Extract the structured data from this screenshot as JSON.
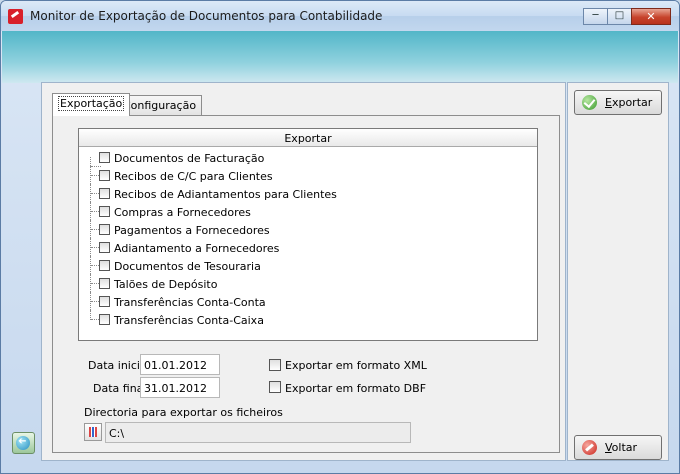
{
  "window": {
    "title": "Monitor de Exportação de Documentos para Contabilidade",
    "controls": {
      "minimize": "─",
      "maximize": "□",
      "close": "✕"
    }
  },
  "tabs": {
    "export": "Exportação",
    "config": "Configuração"
  },
  "list": {
    "header": "Exportar",
    "items": [
      "Documentos de Facturação",
      "Recibos de C/C para Clientes",
      "Recibos de Adiantamentos para Clientes",
      "Compras a Fornecedores",
      "Pagamentos a Fornecedores",
      "Adiantamento a Fornecedores",
      "Documentos de Tesouraria",
      "Talões de Depósito",
      "Transferências Conta-Conta",
      "Transferências Conta-Caixa"
    ]
  },
  "dates": {
    "start_label": "Data inicial",
    "start_value": "01.01.2012",
    "end_label": "Data final",
    "end_value": "31.01.2012"
  },
  "options": {
    "xml_label": "Exportar em formato XML",
    "dbf_label": "Exportar em formato DBF"
  },
  "directory": {
    "label": "Directoria para exportar os ficheiros",
    "value": "C:\\"
  },
  "buttons": {
    "export_rest": "xportar",
    "export_key": "E",
    "back_rest": "oltar",
    "back_key": "V"
  }
}
